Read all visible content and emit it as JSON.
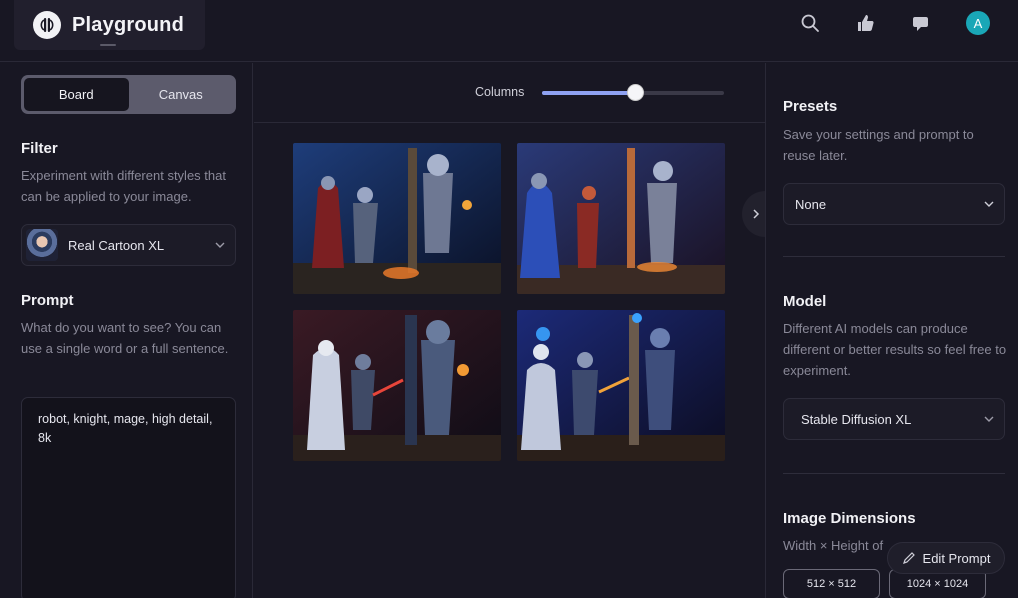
{
  "header": {
    "brand": "Playground",
    "icons": [
      "search-icon",
      "thumbs-up-icon",
      "chat-bubble-icon"
    ],
    "avatar_initial": "A",
    "avatar_color": "#1aa7b7"
  },
  "view_toggle": {
    "options": [
      "Board",
      "Canvas"
    ],
    "active": "Board"
  },
  "filter": {
    "title": "Filter",
    "description": "Experiment with different styles that can be applied to your image.",
    "selected": "Real Cartoon XL"
  },
  "prompt": {
    "title": "Prompt",
    "description": "What do you want to see? You can use a single word or a full sentence.",
    "value": "robot, knight, mage, high detail, 8k"
  },
  "toolbar": {
    "columns_label": "Columns",
    "columns_level": 0.51
  },
  "images": [
    {
      "alt": "generated-image-1"
    },
    {
      "alt": "generated-image-2"
    },
    {
      "alt": "generated-image-3"
    },
    {
      "alt": "generated-image-4"
    }
  ],
  "presets": {
    "title": "Presets",
    "description": "Save your settings and prompt to reuse later.",
    "selected": "None"
  },
  "model": {
    "title": "Model",
    "description": "Different AI models can produce different or better results so feel free to experiment.",
    "selected": "Stable Diffusion XL"
  },
  "dimensions": {
    "title": "Image Dimensions",
    "description": "Width × Height of",
    "options": [
      "512 × 512",
      "1024 × 1024"
    ]
  },
  "edit_prompt_label": "Edit Prompt",
  "colors": {
    "accent": "#8fa2f2",
    "background": "#181723"
  }
}
